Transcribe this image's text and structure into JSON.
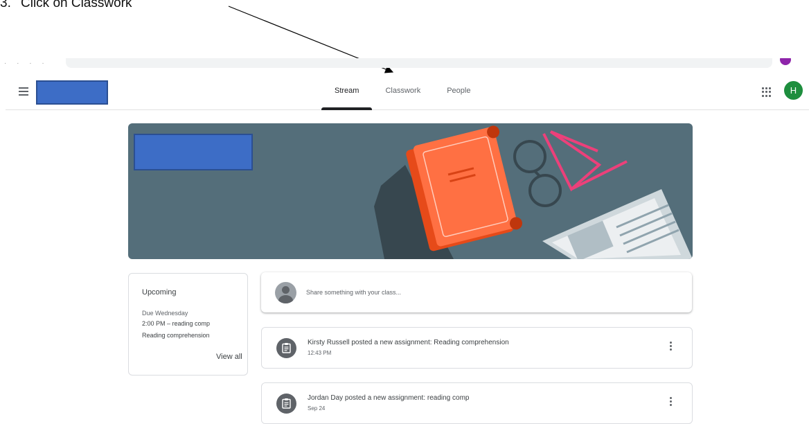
{
  "instruction": {
    "number": "3.",
    "text": "Click on Classwork"
  },
  "header": {
    "tabs": [
      {
        "label": "Stream",
        "active": true
      },
      {
        "label": "Classwork",
        "active": false
      },
      {
        "label": "People",
        "active": false
      }
    ],
    "user_initial": "H"
  },
  "upcoming": {
    "title": "Upcoming",
    "due": "Due Wednesday",
    "item_time": "2:00 PM – reading comp",
    "item_title": "Reading comprehension",
    "view_all": "View all"
  },
  "share": {
    "placeholder": "Share something with your class..."
  },
  "posts": [
    {
      "title": "Kirsty Russell posted a new assignment: Reading comprehension",
      "date": "12:43 PM"
    },
    {
      "title": "Jordan Day posted a new assignment: reading comp",
      "date": "Sep 24"
    }
  ],
  "colors": {
    "accent_green": "#1e8e3e",
    "banner": "#546e7a",
    "redaction_blue": "#3d6dc6",
    "book_orange": "#ff7043"
  }
}
